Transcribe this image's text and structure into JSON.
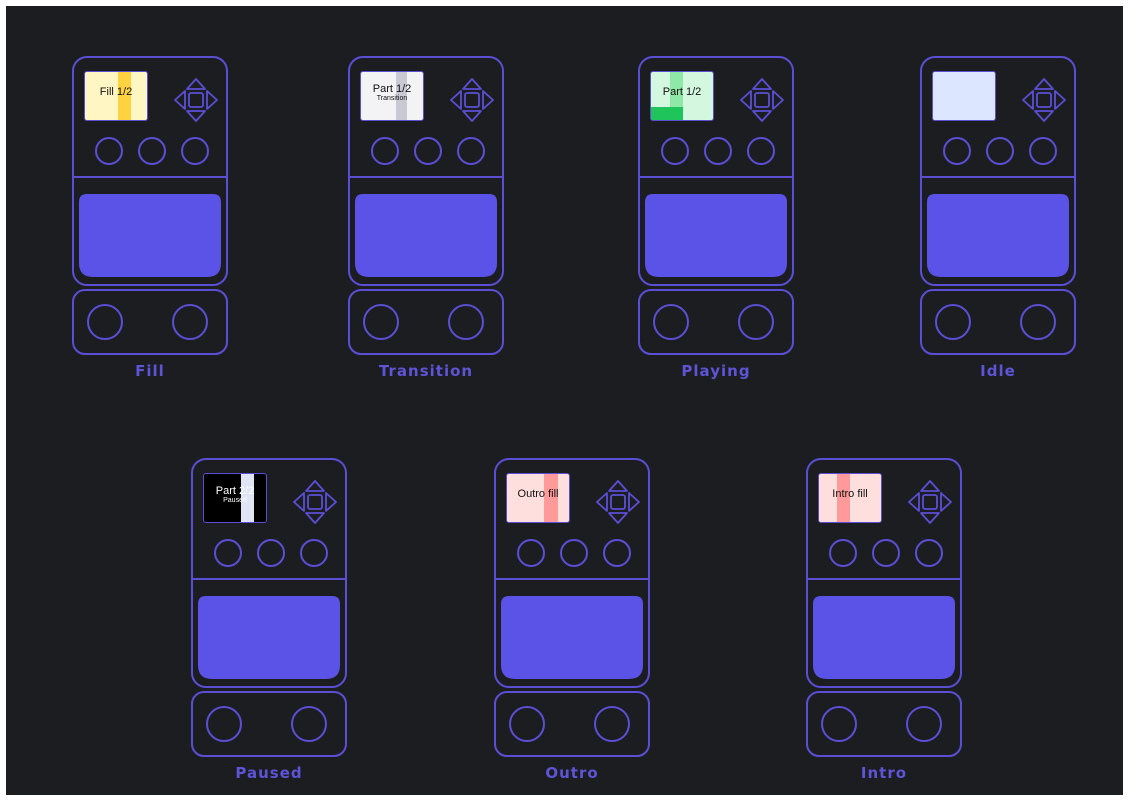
{
  "colors": {
    "background": "#1c1d21",
    "accent": "#5b4fd6",
    "pad_fill": "#5b52e8",
    "label": "#5e54d8"
  },
  "pedals": [
    {
      "id": "fill",
      "label": "Fill",
      "screen": {
        "title": "Fill 1/2",
        "subtitle": "",
        "bg": "#fff6c4",
        "text": "#111111",
        "stripes": [
          {
            "from": 0.52,
            "to": 0.72,
            "color": "#ffd23f"
          }
        ],
        "bottom_bar": null
      }
    },
    {
      "id": "transition",
      "label": "Transition",
      "screen": {
        "title": "Part 1/2",
        "subtitle": "Transition",
        "bg": "#f3f3f6",
        "text": "#111111",
        "stripes": [
          {
            "from": 0.55,
            "to": 0.72,
            "color": "#c9c9d4"
          }
        ],
        "bottom_bar": null
      }
    },
    {
      "id": "playing",
      "label": "Playing",
      "screen": {
        "title": "Part 1/2",
        "subtitle": "",
        "bg": "#d4f7df",
        "text": "#111111",
        "stripes": [
          {
            "from": 0.3,
            "to": 0.5,
            "color": "#8ee8a6"
          }
        ],
        "bottom_bar": {
          "to": 0.5,
          "color": "#1fc45a"
        }
      }
    },
    {
      "id": "idle",
      "label": "Idle",
      "screen": {
        "title": "",
        "subtitle": "",
        "bg": "#dce7ff",
        "text": "#111111",
        "stripes": [],
        "bottom_bar": null
      }
    },
    {
      "id": "paused",
      "label": "Paused",
      "screen": {
        "title": "Part 2/2",
        "subtitle": "Paused",
        "bg": "#000000",
        "text": "#ffffff",
        "stripes": [
          {
            "from": 0.58,
            "to": 0.78,
            "color": "#dfe5f5"
          }
        ],
        "bottom_bar": null
      }
    },
    {
      "id": "outro",
      "label": "Outro",
      "screen": {
        "title": "Outro fill",
        "subtitle": "",
        "bg": "#ffdede",
        "text": "#111111",
        "stripes": [
          {
            "from": 0.58,
            "to": 0.8,
            "color": "#ff9a9a"
          }
        ],
        "bottom_bar": null
      }
    },
    {
      "id": "intro",
      "label": "Intro",
      "screen": {
        "title": "Intro fill",
        "subtitle": "",
        "bg": "#ffdede",
        "text": "#111111",
        "stripes": [
          {
            "from": 0.28,
            "to": 0.48,
            "color": "#ff9a9a"
          }
        ],
        "bottom_bar": null
      }
    }
  ]
}
